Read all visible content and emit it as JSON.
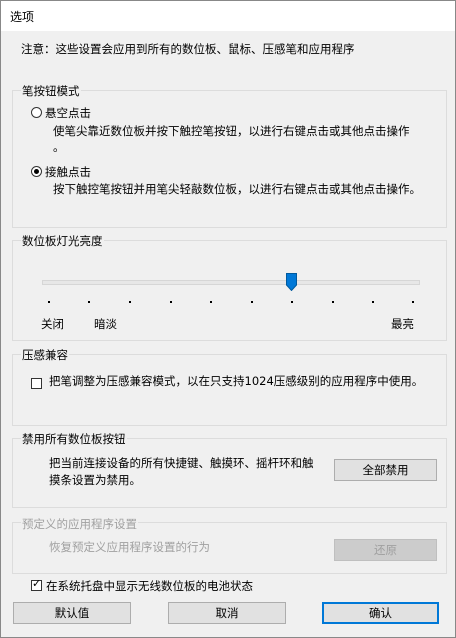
{
  "window": {
    "title": "选项"
  },
  "note": "注意：这些设置会应用到所有的数位板、鼠标、压感笔和应用程序",
  "pen_button_mode": {
    "label": "笔按钮模式",
    "options": [
      {
        "label": "悬空点击",
        "desc_line1": "使笔尖靠近数位板并按下触控笔按钮，以进行右键点击或其他点击操作",
        "desc_line2": "。",
        "selected": false
      },
      {
        "label": "接触点击",
        "desc_line1": "按下触控笔按钮并用笔尖轻敲数位板，以进行右键点击或其他点击操作。",
        "selected": true
      }
    ]
  },
  "brightness": {
    "label": "数位板灯光亮度",
    "levels": [
      "关闭",
      "暗淡",
      "最亮"
    ],
    "value_fraction": 0.67,
    "tick_count": 10
  },
  "pressure_compat": {
    "label": "压感兼容",
    "checkbox_label": "把笔调整为压感兼容模式，以在只支持1024压感级别的应用程序中使用。",
    "checked": false
  },
  "disable_buttons": {
    "label": "禁用所有数位板按钮",
    "desc_line1": "把当前连接设备的所有快捷键、触摸环、摇杆环和触",
    "desc_line2": "摸条设置为禁用。",
    "button_label": "全部禁用"
  },
  "predefined": {
    "label": "预定义的应用程序设置",
    "desc": "恢复预定义应用程序设置的行为",
    "button_label": "还原",
    "disabled": true
  },
  "tray": {
    "checkbox_label": "在系统托盘中显示无线数位板的电池状态",
    "checked": true
  },
  "footer": {
    "default_label": "默认值",
    "cancel_label": "取消",
    "ok_label": "确认"
  },
  "colors": {
    "accent": "#0078d7",
    "thumb": "#0078d7"
  }
}
